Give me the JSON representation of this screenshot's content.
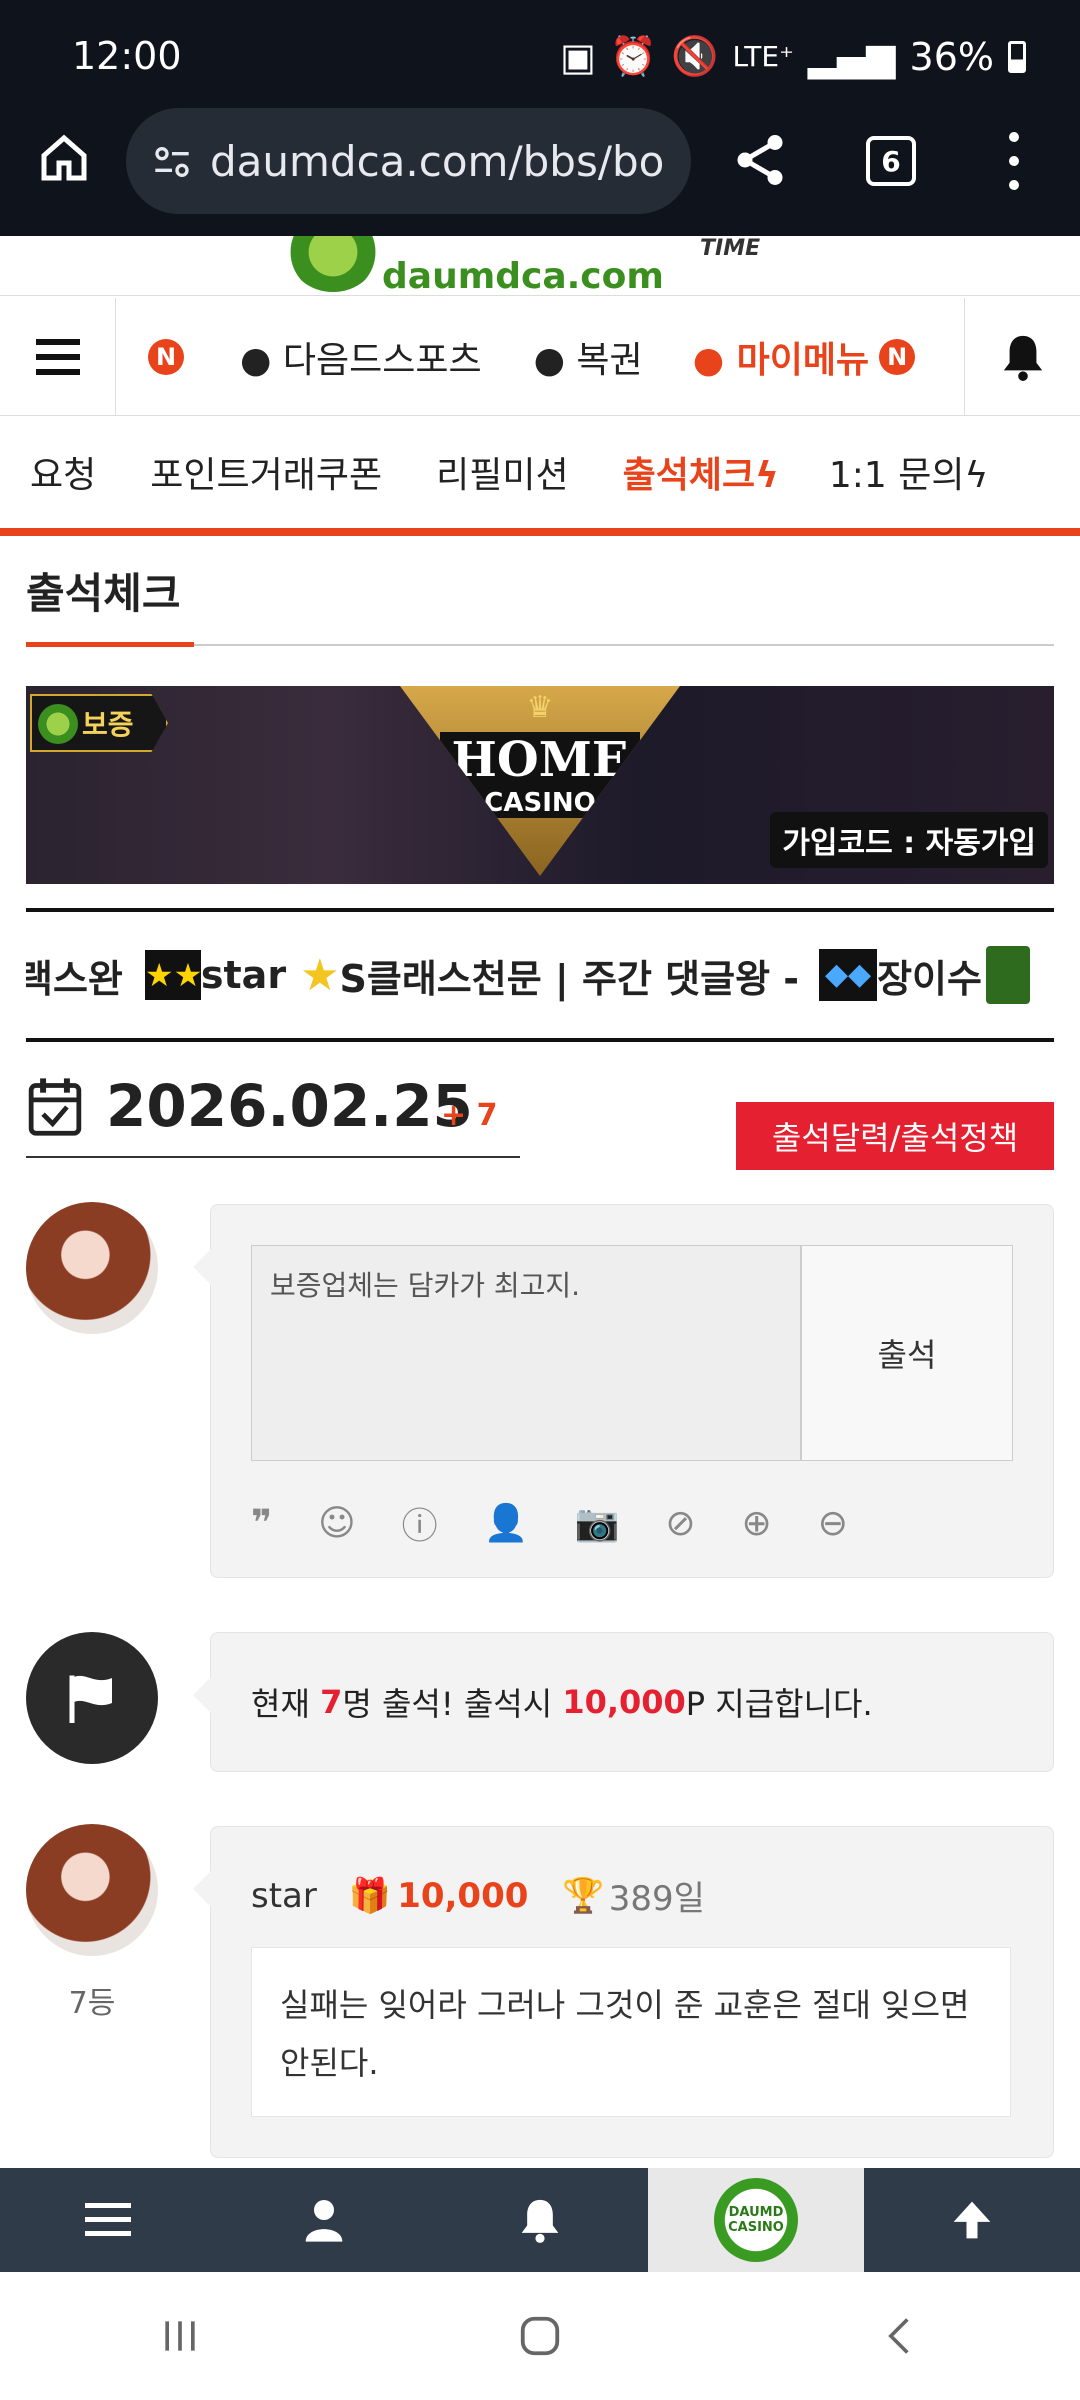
{
  "status": {
    "time": "12:00",
    "network": "LTE⁺",
    "battery": "36%"
  },
  "browser": {
    "url": "daumdca.com/bbs/bo",
    "tab_count": "6"
  },
  "site": {
    "logo_text": "daumdca.com",
    "partner_logo": "TIME"
  },
  "nav1": {
    "new_badge": "N",
    "items": [
      "● 다음드스포츠",
      "● 복권",
      "● 마이메뉴"
    ],
    "mymenu_badge": "N"
  },
  "nav2": {
    "items": [
      "요청",
      "포인트거래쿠폰",
      "리필미션",
      "출석체크",
      "1:1 문의"
    ]
  },
  "page": {
    "title": "출석체크"
  },
  "banner": {
    "badge": "보증",
    "brand_main": "HOME",
    "brand_sub": "CASINO",
    "join_code": "가입코드 : 자동가입"
  },
  "ticker": {
    "items": [
      "랙스완",
      "star",
      "S클래스천문 | 주간 댓글왕 -",
      "장이수"
    ]
  },
  "date": {
    "value": "2026.02.25",
    "plus": "+ 7",
    "button": "출석달력/출석정책"
  },
  "comment_form": {
    "value": "보증업체는 담카가 최고지.",
    "submit": "출석"
  },
  "summary": {
    "prefix": "현재 ",
    "count": "7",
    "mid": "명 출석! 출석시 ",
    "points": "10,000",
    "suffix": "P 지급합니다."
  },
  "entry": {
    "name": "star",
    "points": "10,000",
    "days": "389일",
    "rank": "7등",
    "message": "실패는 잊어라 그러나 그것이 준 교훈은 절대 잊으면 안된다."
  },
  "bottom_nav": {
    "logo_top": "DAUMD",
    "logo_bottom": "CASINO"
  },
  "colors": {
    "accent": "#e8431a",
    "red": "#e52030",
    "nav_dark": "#2f3b48",
    "status_bg": "#0f141c"
  }
}
